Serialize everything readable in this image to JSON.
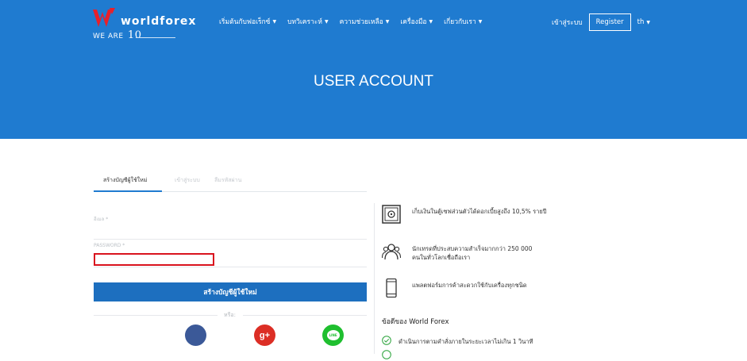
{
  "brand": {
    "name": "worldforex",
    "tagline": "WE ARE",
    "years": "10"
  },
  "nav": {
    "items": [
      "เริ่มต้นกับฟอเร็กซ์",
      "บทวิเคราะห์",
      "ความช่วยเหลือ",
      "เครื่องมือ",
      "เกี่ยวกับเรา"
    ],
    "login": "เข้าสู่ระบบ",
    "register": "Register",
    "lang": "th"
  },
  "hero": {
    "title": "USER ACCOUNT"
  },
  "tabs": [
    "สร้างบัญชีผู้ใช้ใหม่",
    "เข้าสู่ระบบ",
    "ลืมรหัสผ่าน"
  ],
  "form": {
    "email_label": "อีเมล *",
    "password_label": "PASSWORD *",
    "password_value": "",
    "submit": "สร้างบัญชีผู้ใช้ใหม่",
    "or": "หรือ:"
  },
  "social": {
    "google": "g+",
    "line": "LINE"
  },
  "features": [
    "เก็บเงินในตู้เซฟส่วนตัวได้ดอกเบี้ยสูงถึง 10,5% รายปี",
    "นักเทรดที่ประสบความสำเร็จมากกว่า 250 000 คนในทั่วโลกเชื่อถือเรา",
    "แพลตฟอร์มการค้าสะดวกใช้กับเครื่องทุกชนิด"
  ],
  "advantages": {
    "title": "ข้อดีของ World Forex",
    "items": [
      "ดำเนินการตามคำสั่งภายในระยะเวลาไม่เกิน 1 วินาที"
    ]
  },
  "colors": {
    "primary": "#1f7bd0",
    "button": "#1d6fbf",
    "highlight": "#d9131e"
  }
}
